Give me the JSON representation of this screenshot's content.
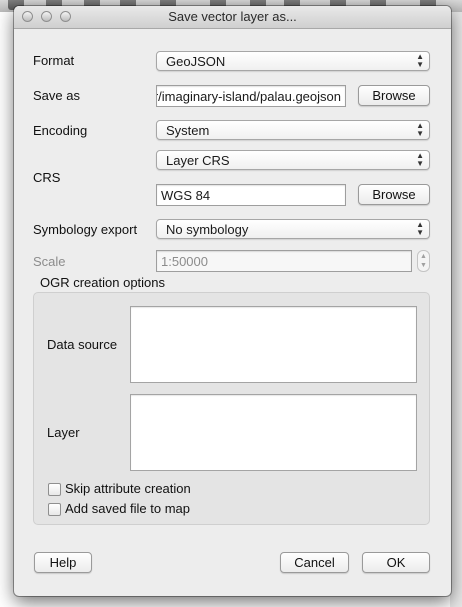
{
  "window": {
    "title": "Save vector layer as..."
  },
  "form": {
    "format_label": "Format",
    "format_value": "GeoJSON",
    "save_as_label": "Save as",
    "save_as_value": "/home/user/imaginary-island/palau.geojson",
    "browse_label": "Browse",
    "encoding_label": "Encoding",
    "encoding_value": "System",
    "crs_label": "CRS",
    "crs_mode_value": "Layer CRS",
    "crs_value": "WGS 84",
    "crs_browse_label": "Browse",
    "symbology_label": "Symbology export",
    "symbology_value": "No symbology",
    "scale_label": "Scale",
    "scale_value": "1:50000"
  },
  "ogr": {
    "group_title": "OGR creation options",
    "data_source_label": "Data source",
    "layer_label": "Layer",
    "skip_attr_label": "Skip attribute creation",
    "skip_attr_checked": false,
    "add_to_map_label": "Add saved file to map",
    "add_to_map_checked": false
  },
  "footer": {
    "help_label": "Help",
    "cancel_label": "Cancel",
    "ok_label": "OK"
  }
}
